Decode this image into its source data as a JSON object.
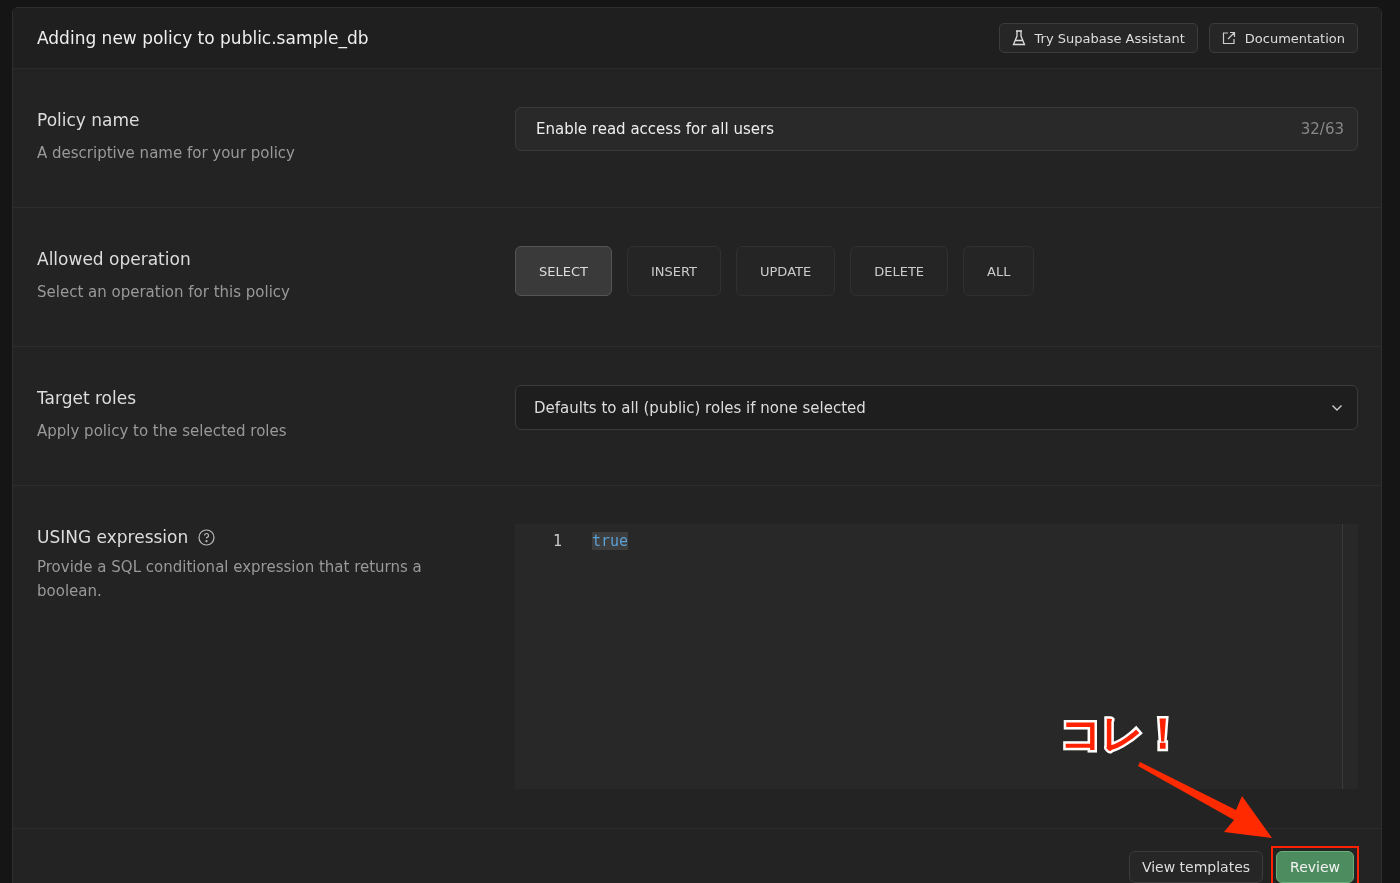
{
  "dialog": {
    "title": "Adding new policy to public.sample_db",
    "header_buttons": [
      {
        "label": "Try Supabase Assistant"
      },
      {
        "label": "Documentation"
      }
    ]
  },
  "policy_name": {
    "label": "Policy name",
    "description": "A descriptive name for your policy",
    "value": "Enable read access for all users",
    "count": "32/63"
  },
  "operation": {
    "label": "Allowed operation",
    "description": "Select an operation for this policy",
    "options": [
      {
        "label": "SELECT",
        "selected": true
      },
      {
        "label": "INSERT",
        "selected": false
      },
      {
        "label": "UPDATE",
        "selected": false
      },
      {
        "label": "DELETE",
        "selected": false
      },
      {
        "label": "ALL",
        "selected": false
      }
    ]
  },
  "target_roles": {
    "label": "Target roles",
    "description": "Apply policy to the selected roles",
    "placeholder": "Defaults to all (public) roles if none selected"
  },
  "using": {
    "label": "USING expression",
    "description": "Provide a SQL conditional expression that returns a boolean.",
    "lines": [
      {
        "number": "1",
        "code": "true"
      }
    ]
  },
  "footer": {
    "buttons": [
      {
        "label": "View templates",
        "kind": "secondary",
        "highlighted": false
      },
      {
        "label": "Review",
        "kind": "primary",
        "highlighted": true
      }
    ]
  },
  "annotation": {
    "text": "コレ！"
  }
}
